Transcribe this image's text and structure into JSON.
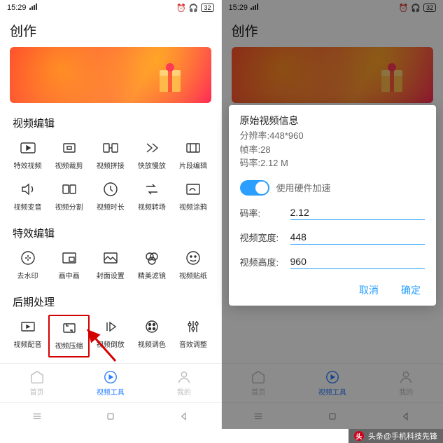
{
  "status": {
    "time": "15:29",
    "battery": "32"
  },
  "app_title": "创作",
  "sections": {
    "video_edit": {
      "label": "视频编辑",
      "tools": [
        {
          "name": "特效视频"
        },
        {
          "name": "视频裁剪"
        },
        {
          "name": "视频拼接"
        },
        {
          "name": "快放慢放"
        },
        {
          "name": "片段编辑"
        },
        {
          "name": "视频变音"
        },
        {
          "name": "视频分割"
        },
        {
          "name": "视频时长"
        },
        {
          "name": "视频转场"
        },
        {
          "name": "视频涂鸦"
        }
      ]
    },
    "fx_edit": {
      "label": "特效编辑",
      "tools": [
        {
          "name": "去水印"
        },
        {
          "name": "画中画"
        },
        {
          "name": "封面设置"
        },
        {
          "name": "精美滤镜"
        },
        {
          "name": "视频贴纸"
        }
      ]
    },
    "post": {
      "label": "后期处理",
      "tools": [
        {
          "name": "视频配音"
        },
        {
          "name": "视频压缩"
        },
        {
          "name": "视频倒放"
        },
        {
          "name": "视频调色"
        },
        {
          "name": "音效调整"
        }
      ]
    }
  },
  "nav": {
    "home": "首页",
    "tools": "视频工具",
    "mine": "我的"
  },
  "modal": {
    "title": "原始视频信息",
    "resolution_label": "分辨率:448*960",
    "fps_label": "帧率:28",
    "bitrate_info": "码率:2.12 M",
    "hw_accel": "使用硬件加速",
    "bitrate_field": "码率:",
    "bitrate_value": "2.12",
    "width_field": "视频宽度:",
    "width_value": "448",
    "height_field": "视频高度:",
    "height_value": "960",
    "cancel": "取消",
    "confirm": "确定"
  },
  "attribution": "头条@手机科技先锋"
}
